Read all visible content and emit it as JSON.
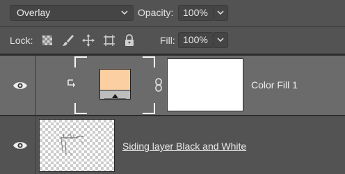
{
  "top_bar": {
    "blend_mode": "Overlay",
    "opacity_label": "Opacity:",
    "opacity_value": "100%"
  },
  "lock_bar": {
    "lock_label": "Lock:",
    "lock_icons": [
      "lock-transparent-pixels-icon",
      "lock-image-pixels-icon",
      "lock-position-icon",
      "lock-artboard-icon",
      "lock-all-icon"
    ],
    "fill_label": "Fill:",
    "fill_value": "100%"
  },
  "layers": [
    {
      "name": "Color Fill 1",
      "visible": true,
      "selected": true,
      "fill_color": "#fbcfa2",
      "clipped": true,
      "has_mask": true,
      "mask_color": "#ffffff"
    },
    {
      "name": "Siding layer Black and White",
      "visible": true,
      "selected": false
    }
  ],
  "colors": {
    "panel_bg": "#535353",
    "selected_row_bg": "#6b6b6b",
    "field_bg": "#454545"
  }
}
